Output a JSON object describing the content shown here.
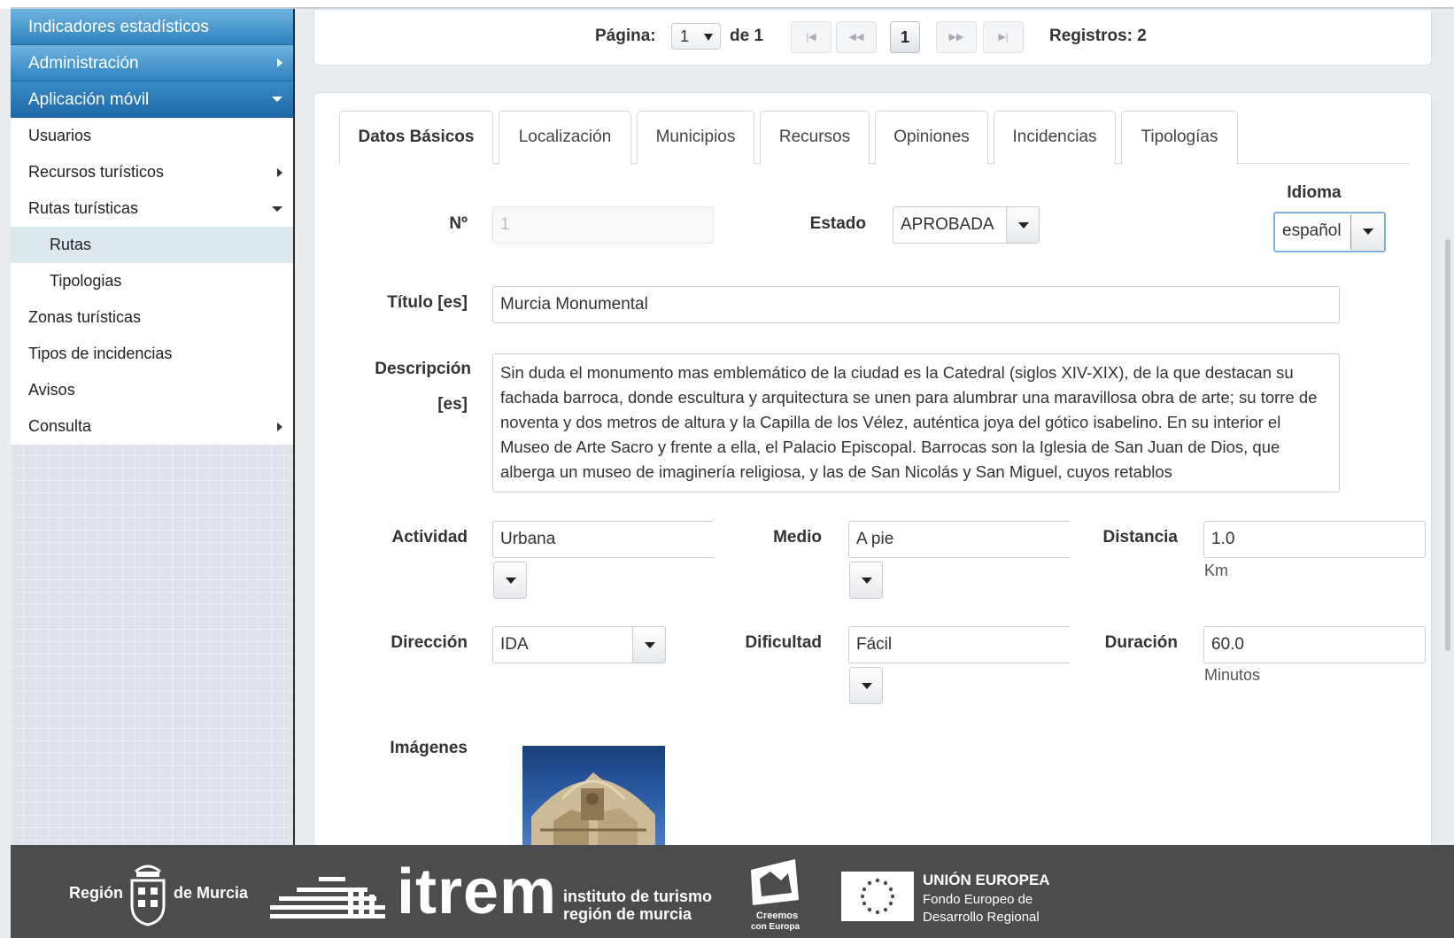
{
  "sidebar": {
    "items": [
      {
        "label": "Indicadores estadísticos",
        "kind": "head",
        "arrow": ""
      },
      {
        "label": "Administración",
        "kind": "head",
        "arrow": "right"
      },
      {
        "label": "Aplicación móvil",
        "kind": "head-dark",
        "arrow": "down"
      },
      {
        "label": "Usuarios",
        "kind": "item",
        "arrow": ""
      },
      {
        "label": "Recursos turísticos",
        "kind": "item",
        "arrow": "right"
      },
      {
        "label": "Rutas turísticas",
        "kind": "item",
        "arrow": "down"
      },
      {
        "label": "Rutas",
        "kind": "sub-active",
        "arrow": ""
      },
      {
        "label": "Tipologias",
        "kind": "sub",
        "arrow": ""
      },
      {
        "label": "Zonas turísticas",
        "kind": "item",
        "arrow": ""
      },
      {
        "label": "Tipos de incidencias",
        "kind": "item",
        "arrow": ""
      },
      {
        "label": "Avisos",
        "kind": "item",
        "arrow": ""
      },
      {
        "label": "Consulta",
        "kind": "item",
        "arrow": "right"
      }
    ]
  },
  "pager": {
    "page_label": "Página:",
    "page_value": "1",
    "of_label": "de 1",
    "first": "|◀",
    "prev": "◀◀",
    "current": "1",
    "next": "▶▶",
    "last": "▶|",
    "records_label": "Registros: 2"
  },
  "tabs": [
    "Datos Básicos",
    "Localización",
    "Municipios",
    "Recursos",
    "Opiniones",
    "Incidencias",
    "Tipologías"
  ],
  "form": {
    "num_label": "Nº",
    "num_value": "1",
    "estado_label": "Estado",
    "estado_value": "APROBADA",
    "idioma_label": "Idioma",
    "idioma_value": "español",
    "titulo_label": "Título [es]",
    "titulo_value": "Murcia Monumental",
    "descripcion_label_1": "Descripción",
    "descripcion_label_2": "[es]",
    "descripcion_value": "Sin duda el monumento mas emblemático de la ciudad es la Catedral (siglos XIV-XIX), de la que destacan su fachada barroca, donde escultura y arquitectura se unen para alumbrar una maravillosa obra de arte; su torre de noventa y dos metros de altura y la Capilla de los Vélez, auténtica joya del gótico isabelino. En su interior el Museo de Arte Sacro y frente a ella, el Palacio Episcopal. Barrocas son la Iglesia de San Juan de Dios, que alberga un museo de imaginería religiosa, y las de San Nicolás y San Miguel, cuyos retablos",
    "actividad_label": "Actividad",
    "actividad_value": "Urbana",
    "medio_label": "Medio",
    "medio_value": "A pie",
    "distancia_label": "Distancia",
    "distancia_value": "1.0",
    "distancia_unit": "Km",
    "direccion_label": "Dirección",
    "direccion_value": "IDA",
    "dificultad_label": "Dificultad",
    "dificultad_value": "Fácil",
    "duracion_label": "Duración",
    "duracion_value": "60.0",
    "duracion_unit": "Minutos",
    "imagenes_label": "Imágenes"
  },
  "footer": {
    "region_left": "Región",
    "region_right": "de Murcia",
    "itrem": "itrem",
    "itrem_sub_1": "instituto de turismo",
    "itrem_sub_2": "región de murcia",
    "creemos_1": "Creemos",
    "creemos_2": "con Europa",
    "ue_title": "UNIÓN EUROPEA",
    "ue_sub_1": "Fondo Europeo de",
    "ue_sub_2": "Desarrollo Regional"
  },
  "colors": {
    "menu_head": "#2f82bd",
    "footer_bg": "#4b4c4e",
    "active_sub": "#dde8ef"
  }
}
